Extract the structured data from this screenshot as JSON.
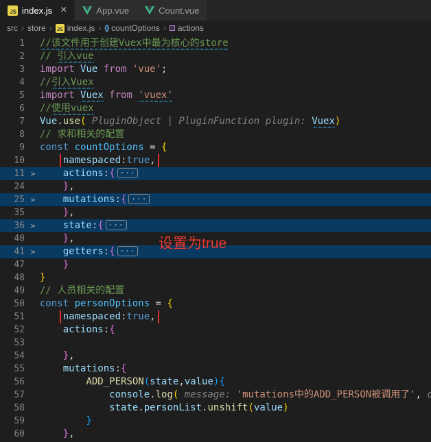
{
  "colors": {
    "annotation_red": "#e12f2f",
    "fold_highlight": "#083a62",
    "accent_js": "#e8d44d",
    "accent_vue": "#41b883"
  },
  "tabs": [
    {
      "label": "index.js",
      "icon": "js",
      "active": true,
      "closable": true
    },
    {
      "label": "App.vue",
      "icon": "vue",
      "active": false,
      "closable": false
    },
    {
      "label": "Count.vue",
      "icon": "vue",
      "active": false,
      "closable": false
    }
  ],
  "breadcrumb": {
    "items": [
      {
        "label": "src"
      },
      {
        "label": "store"
      },
      {
        "label": "index.js",
        "icon": "js"
      },
      {
        "label": "countOptions",
        "icon": "symbol-object"
      },
      {
        "label": "actions",
        "icon": "symbol-field"
      }
    ]
  },
  "annotations": {
    "callout": "设置为true"
  },
  "editor": {
    "chevron": ">",
    "fold_badge": "···",
    "lines": [
      {
        "n": "1",
        "tokens": [
          {
            "t": "//该文件用于创建Vuex中最为核心的store",
            "c": "cm",
            "sq": 1
          }
        ]
      },
      {
        "n": "2",
        "tokens": [
          {
            "t": "// ",
            "c": "cm"
          },
          {
            "t": "引入vue",
            "c": "cm",
            "sq": 1
          }
        ]
      },
      {
        "n": "3",
        "tokens": [
          {
            "t": "import ",
            "c": "kw"
          },
          {
            "t": "Vue",
            "c": "var"
          },
          {
            "t": " from ",
            "c": "kw"
          },
          {
            "t": "'vue'",
            "c": "str"
          },
          {
            "t": ";",
            "c": "pl"
          }
        ]
      },
      {
        "n": "4",
        "tokens": [
          {
            "t": "//",
            "c": "cm"
          },
          {
            "t": "引入Vuex",
            "c": "cm",
            "sq": 1
          }
        ]
      },
      {
        "n": "5",
        "tokens": [
          {
            "t": "import ",
            "c": "kw"
          },
          {
            "t": "Vuex",
            "c": "var",
            "sq": 1
          },
          {
            "t": " from ",
            "c": "kw"
          },
          {
            "t": "'vuex'",
            "c": "str",
            "sq": 1
          }
        ]
      },
      {
        "n": "6",
        "tokens": [
          {
            "t": "//",
            "c": "cm"
          },
          {
            "t": "使用vuex",
            "c": "cm",
            "sq": 1
          }
        ]
      },
      {
        "n": "7",
        "tokens": [
          {
            "t": "Vue",
            "c": "var"
          },
          {
            "t": ".",
            "c": "pl"
          },
          {
            "t": "use",
            "c": "fn"
          },
          {
            "t": "(",
            "c": "b1"
          },
          {
            "t": " PluginObject | PluginFunction plugin: ",
            "c": "hint"
          },
          {
            "t": "Vuex",
            "c": "var",
            "sq": 1
          },
          {
            "t": ")",
            "c": "b1"
          }
        ]
      },
      {
        "n": "8",
        "tokens": [
          {
            "t": "// 求和相关的配置",
            "c": "cm"
          }
        ]
      },
      {
        "n": "9",
        "tokens": [
          {
            "t": "const ",
            "c": "st"
          },
          {
            "t": "countOptions",
            "c": "cvar"
          },
          {
            "t": " = ",
            "c": "pl"
          },
          {
            "t": "{",
            "c": "b1"
          }
        ]
      },
      {
        "n": "10",
        "tokens": [
          {
            "t": "    ",
            "c": "pl"
          },
          {
            "t": "namespaced",
            "c": "var",
            "rb": 1
          },
          {
            "t": ":",
            "c": "pl",
            "rb": 1
          },
          {
            "t": "true",
            "c": "bool",
            "rb": 1
          },
          {
            "t": ",",
            "c": "pl",
            "rb": 1
          }
        ]
      },
      {
        "n": "11",
        "chev": 1,
        "hl": 1,
        "fold": 1,
        "tokens": [
          {
            "t": "    ",
            "c": "pl"
          },
          {
            "t": "actions",
            "c": "var"
          },
          {
            "t": ":",
            "c": "pl"
          },
          {
            "t": "{",
            "c": "b2"
          }
        ]
      },
      {
        "n": "24",
        "tokens": [
          {
            "t": "    ",
            "c": "pl"
          },
          {
            "t": "}",
            "c": "b2"
          },
          {
            "t": ",",
            "c": "pl"
          }
        ]
      },
      {
        "n": "25",
        "chev": 1,
        "hl": 1,
        "fold": 1,
        "tokens": [
          {
            "t": "    ",
            "c": "pl"
          },
          {
            "t": "mutations",
            "c": "var"
          },
          {
            "t": ":",
            "c": "pl"
          },
          {
            "t": "{",
            "c": "b2"
          }
        ]
      },
      {
        "n": "35",
        "tokens": [
          {
            "t": "    ",
            "c": "pl"
          },
          {
            "t": "}",
            "c": "b2"
          },
          {
            "t": ",",
            "c": "pl"
          }
        ]
      },
      {
        "n": "36",
        "chev": 1,
        "hl": 1,
        "fold": 1,
        "tokens": [
          {
            "t": "    ",
            "c": "pl"
          },
          {
            "t": "state",
            "c": "var"
          },
          {
            "t": ":",
            "c": "pl"
          },
          {
            "t": "{",
            "c": "b2"
          }
        ]
      },
      {
        "n": "40",
        "tokens": [
          {
            "t": "    ",
            "c": "pl"
          },
          {
            "t": "}",
            "c": "b2"
          },
          {
            "t": ",",
            "c": "pl"
          }
        ]
      },
      {
        "n": "41",
        "chev": 1,
        "hl": 1,
        "fold": 1,
        "tokens": [
          {
            "t": "    ",
            "c": "pl"
          },
          {
            "t": "getters",
            "c": "var"
          },
          {
            "t": ":",
            "c": "pl"
          },
          {
            "t": "{",
            "c": "b2"
          }
        ]
      },
      {
        "n": "47",
        "tokens": [
          {
            "t": "    ",
            "c": "pl"
          },
          {
            "t": "}",
            "c": "b2"
          }
        ]
      },
      {
        "n": "48",
        "tokens": [
          {
            "t": "}",
            "c": "b1"
          }
        ]
      },
      {
        "n": "49",
        "tokens": [
          {
            "t": "// 人员相关的配置",
            "c": "cm"
          }
        ]
      },
      {
        "n": "50",
        "tokens": [
          {
            "t": "const ",
            "c": "st"
          },
          {
            "t": "personOptions",
            "c": "cvar"
          },
          {
            "t": " = ",
            "c": "pl"
          },
          {
            "t": "{",
            "c": "b1"
          }
        ]
      },
      {
        "n": "51",
        "tokens": [
          {
            "t": "    ",
            "c": "pl"
          },
          {
            "t": "namespaced",
            "c": "var",
            "rb": 1
          },
          {
            "t": ":",
            "c": "pl",
            "rb": 1
          },
          {
            "t": "true",
            "c": "bool",
            "rb": 1
          },
          {
            "t": ",",
            "c": "pl",
            "rb": 1
          }
        ]
      },
      {
        "n": "52",
        "tokens": [
          {
            "t": "    ",
            "c": "pl"
          },
          {
            "t": "actions",
            "c": "var"
          },
          {
            "t": ":",
            "c": "pl"
          },
          {
            "t": "{",
            "c": "b2"
          }
        ]
      },
      {
        "n": "53",
        "tokens": []
      },
      {
        "n": "54",
        "tokens": [
          {
            "t": "    ",
            "c": "pl"
          },
          {
            "t": "}",
            "c": "b2"
          },
          {
            "t": ",",
            "c": "pl"
          }
        ]
      },
      {
        "n": "55",
        "tokens": [
          {
            "t": "    ",
            "c": "pl"
          },
          {
            "t": "mutations",
            "c": "var"
          },
          {
            "t": ":",
            "c": "pl"
          },
          {
            "t": "{",
            "c": "b2"
          }
        ]
      },
      {
        "n": "56",
        "tokens": [
          {
            "t": "        ",
            "c": "pl"
          },
          {
            "t": "ADD_PERSON",
            "c": "fn"
          },
          {
            "t": "(",
            "c": "b3"
          },
          {
            "t": "state",
            "c": "var"
          },
          {
            "t": ",",
            "c": "pl"
          },
          {
            "t": "value",
            "c": "var"
          },
          {
            "t": ")",
            "c": "b3"
          },
          {
            "t": "{",
            "c": "b3"
          }
        ]
      },
      {
        "n": "57",
        "tokens": [
          {
            "t": "            ",
            "c": "pl"
          },
          {
            "t": "console",
            "c": "var"
          },
          {
            "t": ".",
            "c": "pl"
          },
          {
            "t": "log",
            "c": "fn"
          },
          {
            "t": "(",
            "c": "b1"
          },
          {
            "t": " message: ",
            "c": "hint"
          },
          {
            "t": "'mutations中的ADD_PERSON被调用了'",
            "c": "str"
          },
          {
            "t": ", ",
            "c": "pl"
          },
          {
            "t": "optionalPa",
            "c": "hint"
          }
        ]
      },
      {
        "n": "58",
        "tokens": [
          {
            "t": "            ",
            "c": "pl"
          },
          {
            "t": "state",
            "c": "var"
          },
          {
            "t": ".",
            "c": "pl"
          },
          {
            "t": "personList",
            "c": "var"
          },
          {
            "t": ".",
            "c": "pl"
          },
          {
            "t": "unshift",
            "c": "fn"
          },
          {
            "t": "(",
            "c": "b1"
          },
          {
            "t": "value",
            "c": "var"
          },
          {
            "t": ")",
            "c": "b1"
          }
        ]
      },
      {
        "n": "59",
        "tokens": [
          {
            "t": "        ",
            "c": "pl"
          },
          {
            "t": "}",
            "c": "b3"
          }
        ]
      },
      {
        "n": "60",
        "tokens": [
          {
            "t": "    ",
            "c": "pl"
          },
          {
            "t": "}",
            "c": "b2"
          },
          {
            "t": ",",
            "c": "pl"
          }
        ]
      }
    ]
  }
}
